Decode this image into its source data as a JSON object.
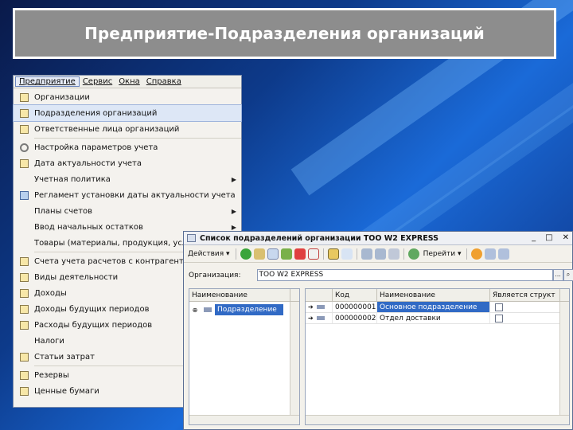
{
  "slide_title": "Предприятие-Подразделения организаций",
  "menubar": {
    "items": [
      "Предприятие",
      "Сервис",
      "Окна",
      "Справка"
    ]
  },
  "menu": {
    "items": [
      {
        "label": "Организации",
        "icon": "catalog-icon",
        "submenu": false
      },
      {
        "label": "Подразделения организаций",
        "icon": "catalog-icon",
        "submenu": false,
        "highlighted": true
      },
      {
        "label": "Ответственные лица организаций",
        "icon": "catalog-icon",
        "submenu": false,
        "sep_after": true
      },
      {
        "label": "Настройка параметров учета",
        "icon": "gear-icon",
        "submenu": false
      },
      {
        "label": "Дата актуальности учета",
        "icon": "catalog-icon",
        "submenu": false
      },
      {
        "label": "Учетная политика",
        "icon": "",
        "submenu": true
      },
      {
        "label": "Регламент установки даты актуальности учета",
        "icon": "schedule-icon",
        "submenu": false
      },
      {
        "label": "Планы счетов",
        "icon": "",
        "submenu": true
      },
      {
        "label": "Ввод начальных остатков",
        "icon": "",
        "submenu": true
      },
      {
        "label": "Товары (материалы, продукция, услуги)",
        "icon": "",
        "submenu": false,
        "sep_after": true
      },
      {
        "label": "Счета учета расчетов с контрагентами",
        "icon": "catalog-icon",
        "submenu": false
      },
      {
        "label": "Виды деятельности",
        "icon": "catalog-icon",
        "submenu": false
      },
      {
        "label": "Доходы",
        "icon": "catalog-icon",
        "submenu": false
      },
      {
        "label": "Доходы будущих периодов",
        "icon": "catalog-icon",
        "submenu": false
      },
      {
        "label": "Расходы будущих периодов",
        "icon": "catalog-icon",
        "submenu": false
      },
      {
        "label": "Налоги",
        "icon": "",
        "submenu": false
      },
      {
        "label": "Статьи затрат",
        "icon": "catalog-icon",
        "submenu": false,
        "sep_after": true
      },
      {
        "label": "Резервы",
        "icon": "catalog-icon",
        "submenu": false
      },
      {
        "label": "Ценные бумаги",
        "icon": "catalog-icon",
        "submenu": false
      }
    ]
  },
  "dialog": {
    "title": "Список подразделений организации ТОО W2 EXPRESS",
    "toolbar": {
      "actions_label": "Действия",
      "goto_label": "Перейти"
    },
    "org_label": "Организация:",
    "org_value": "ТОО W2 EXPRESS",
    "tree_header": "Наименование",
    "tree_item": "Подразделение орг",
    "grid_headers": [
      "Код",
      "Наименование",
      "Является структ"
    ],
    "rows": [
      {
        "code": "000000001",
        "name": "Основное подразделение",
        "selected": true
      },
      {
        "code": "000000002",
        "name": "Отдел доставки",
        "selected": false
      }
    ]
  },
  "colors": {
    "selection": "#316ac5",
    "title_bg": "#8d8d8d"
  }
}
